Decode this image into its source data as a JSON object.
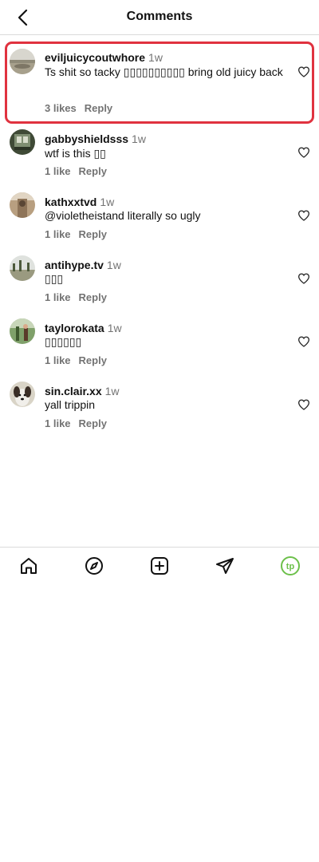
{
  "header": {
    "title": "Comments",
    "back_icon": "chevron-left-icon"
  },
  "comments": [
    {
      "username": "eviljuicycoutwhore",
      "time": "1w",
      "text": "Ts shit so tacky ▯▯▯▯▯▯▯▯▯▯ bring old juicy back",
      "likes": "3 likes",
      "reply": "Reply",
      "highlighted": true
    },
    {
      "username": "gabbyshieldsss",
      "time": "1w",
      "text": "wtf is this ▯▯",
      "likes": "1 like",
      "reply": "Reply"
    },
    {
      "username": "kathxxtvd",
      "time": "1w",
      "text": "@violetheistand literally so ugly",
      "likes": "1 like",
      "reply": "Reply"
    },
    {
      "username": "antihype.tv",
      "time": "1w",
      "text": "▯▯▯",
      "likes": "1 like",
      "reply": "Reply"
    },
    {
      "username": "taylorokata",
      "time": "1w",
      "text": "▯▯▯▯▯▯",
      "likes": "1 like",
      "reply": "Reply"
    },
    {
      "username": "sin.clair.xx",
      "time": "1w",
      "text": "yall trippin",
      "likes": "1 like",
      "reply": "Reply"
    }
  ],
  "tabbar": {
    "items": [
      "home-icon",
      "explore-compass-icon",
      "create-post-icon",
      "direct-message-icon",
      "profile-avatar-icon"
    ],
    "profile_initials": "tp",
    "profile_color": "#6cc04a"
  },
  "colors": {
    "highlight": "#e0323f",
    "muted": "#737373",
    "divider": "#dbdbdb"
  }
}
